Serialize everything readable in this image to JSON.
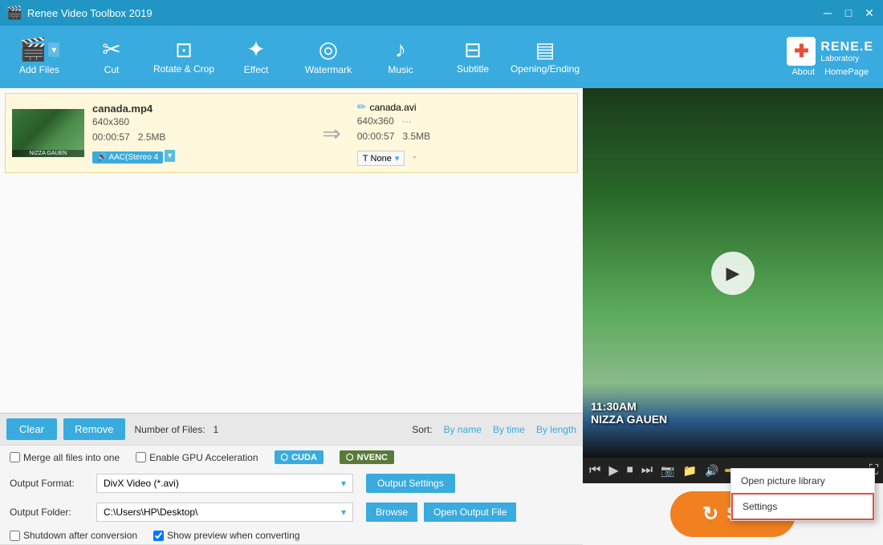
{
  "app": {
    "title": "Renee Video Toolbox 2019",
    "logo_cross": "✚",
    "logo_name": "RENE.E",
    "logo_sub": "Laboratory",
    "about_label": "About",
    "homepage_label": "HomePage"
  },
  "toolbar": {
    "items": [
      {
        "id": "add-files",
        "label": "Add Files",
        "icon": "🎬"
      },
      {
        "id": "cut",
        "label": "Cut",
        "icon": "✂"
      },
      {
        "id": "rotate-crop",
        "label": "Rotate & Crop",
        "icon": "⊡"
      },
      {
        "id": "effect",
        "label": "Effect",
        "icon": "✦"
      },
      {
        "id": "watermark",
        "label": "Watermark",
        "icon": "◎"
      },
      {
        "id": "music",
        "label": "Music",
        "icon": "♪"
      },
      {
        "id": "subtitle",
        "label": "Subtitle",
        "icon": "⊟"
      },
      {
        "id": "opening-ending",
        "label": "Opening/Ending",
        "icon": "▤"
      }
    ]
  },
  "file_item": {
    "input_name": "canada.mp4",
    "input_res": "640x360",
    "input_duration": "00:00:57",
    "input_size": "2.5MB",
    "audio": "AAC(Stereo 4",
    "output_name": "canada.avi",
    "output_res": "640x360",
    "output_duration": "00:00:57",
    "output_size": "3.5MB",
    "subtitle_label": "None",
    "thumb_label": "NIZZA GAUEN"
  },
  "bottom": {
    "clear_label": "Clear",
    "remove_label": "Remove",
    "file_count_label": "Number of Files:",
    "file_count": "1",
    "sort_label": "Sort:",
    "sort_by_name": "By name",
    "sort_by_time": "By time",
    "sort_by_length": "By length"
  },
  "settings": {
    "merge_label": "Merge all files into one",
    "gpu_label": "Enable GPU Acceleration",
    "cuda_label": "CUDA",
    "nvenc_label": "NVENC"
  },
  "output_format": {
    "label": "Output Format:",
    "value": "DivX Video (*.avi)",
    "settings_btn": "Output Settings"
  },
  "output_folder": {
    "label": "Output Folder:",
    "value": "C:\\Users\\HP\\Desktop\\",
    "browse_btn": "Browse",
    "open_btn": "Open Output File"
  },
  "shutdown": {
    "shutdown_label": "Shutdown after conversion",
    "preview_label": "Show preview when converting",
    "preview_checked": true
  },
  "video_player": {
    "time_label": "11:30AM",
    "location_label": "NIZZA GAUEN"
  },
  "popup_menu": {
    "items": [
      {
        "id": "open-picture",
        "label": "Open picture library",
        "selected": false
      },
      {
        "id": "settings",
        "label": "Settings",
        "selected": true
      }
    ]
  },
  "start": {
    "label": "Start"
  }
}
